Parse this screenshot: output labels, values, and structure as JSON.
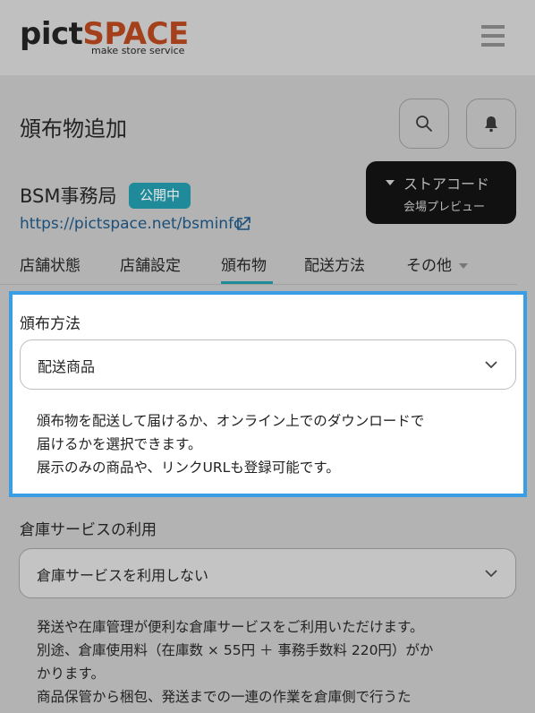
{
  "header": {
    "logo_pict": "pict",
    "logo_space": "SPACE",
    "logo_sub": "make store service",
    "menu_icon": "hamburger-menu-icon"
  },
  "page": {
    "title": "頒布物追加",
    "search_icon": "search-icon",
    "bell_icon": "bell-icon"
  },
  "store": {
    "name": "BSM事務局",
    "status": "公開中",
    "url": "https://pictspace.net/bsminfo",
    "preview_line1": "ストアコード",
    "preview_line2": "会場プレビュー"
  },
  "tabs": [
    {
      "label": "店舗状態"
    },
    {
      "label": "店舗設定"
    },
    {
      "label": "頒布物",
      "active": true
    },
    {
      "label": "配送方法"
    },
    {
      "label": "その他"
    }
  ],
  "distribution": {
    "label": "頒布方法",
    "selected": "配送商品",
    "desc": [
      "頒布物を配送して届けるか、オンライン上でのダウンロードで",
      "届けるかを選択できます。",
      "展示のみの商品や、リンクURLも登録可能です。"
    ]
  },
  "warehouse": {
    "label": "倉庫サービスの利用",
    "selected": "倉庫サービスを利用しない",
    "desc": [
      "発送や在庫管理が便利な倉庫サービスをご利用いただけます。",
      "別途、倉庫使用料（在庫数 × 55円 ＋ 事務手数料 220円）がか",
      "かります。",
      "商品保管から梱包、発送までの一連の作業を倉庫側で行うた"
    ]
  },
  "colors": {
    "accent": "#1f8a99",
    "highlight_border": "#3a9ee6",
    "logo_space": "#a5401c"
  }
}
